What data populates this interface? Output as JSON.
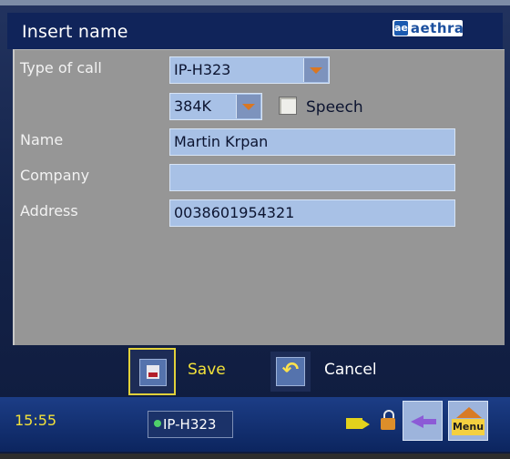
{
  "window": {
    "title": "Insert name",
    "brand": {
      "mark": "ae",
      "name": "aethra"
    }
  },
  "form": {
    "type_of_call_label": "Type of call",
    "type_of_call_value": "IP-H323",
    "speed_value": "384K",
    "speech_label": "Speech",
    "speech_checked": false,
    "name_label": "Name",
    "name_value": "Martin Krpan",
    "company_label": "Company",
    "company_value": "",
    "address_label": "Address",
    "address_value": "0038601954321"
  },
  "buttons": {
    "save_label": "Save",
    "cancel_label": "Cancel"
  },
  "status": {
    "time": "15:55",
    "connection": "IP-H323",
    "menu_label": "Menu"
  },
  "icons": {
    "save": "floppy-disk-icon",
    "cancel": "undo-arrow-icon",
    "camera": "video-camera-icon",
    "lock": "padlock-icon",
    "back": "back-arrow-icon",
    "menu": "menu-home-icon"
  },
  "colors": {
    "title_bar": "#10245a",
    "panel": "#969696",
    "field": "#a8c1e6",
    "accent_yellow": "#f2e13a"
  }
}
